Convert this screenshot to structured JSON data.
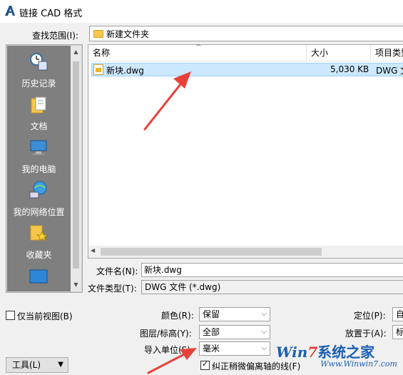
{
  "window": {
    "title": "链接 CAD 格式",
    "app_icon": "autocad-icon"
  },
  "look_in": {
    "label": "查找范围(I):",
    "value": "新建文件夹",
    "icon": "folder-icon"
  },
  "places": [
    {
      "label": "历史记录",
      "icon": "history-icon"
    },
    {
      "label": "文档",
      "icon": "documents-icon"
    },
    {
      "label": "我的电脑",
      "icon": "my-computer-icon"
    },
    {
      "label": "我的网络位置",
      "icon": "network-icon"
    },
    {
      "label": "收藏夹",
      "icon": "favorites-icon"
    },
    {
      "label": "",
      "icon": "desktop-icon"
    }
  ],
  "file_list": {
    "columns": [
      "名称",
      "大小",
      "项目类型"
    ],
    "rows": [
      {
        "name": "新块.dwg",
        "size": "5,030 KB",
        "type": "DWG 文"
      }
    ]
  },
  "file_name": {
    "label": "文件名(N):",
    "value": "新块.dwg"
  },
  "file_type": {
    "label": "文件类型(T):",
    "value": "DWG 文件 (*.dwg)"
  },
  "options": {
    "current_view_only": {
      "label": "仅当前视图(B)",
      "checked": false
    },
    "color": {
      "label": "颜色(R):",
      "value": "保留"
    },
    "layers": {
      "label": "图层/标高(Y):",
      "value": "全部"
    },
    "import_units": {
      "label": "导入单位(S):",
      "value": "毫米"
    },
    "correct_offaxis": {
      "label": "纠正稍微偏离轴的线(F)",
      "checked": true
    },
    "positioning": {
      "label": "定位(P):",
      "value": "自"
    },
    "place_at": {
      "label": "放置于(A):",
      "value": "标"
    }
  },
  "tools_button": {
    "label": "工具(L)"
  },
  "watermark": {
    "logo_prefix": "Win",
    "logo_seven": "7",
    "logo_cn": "系统之家",
    "url": "Www.Winwin7.com"
  },
  "colors": {
    "annotation_arrow": "#e8413a",
    "selection": "#cce8ff"
  }
}
